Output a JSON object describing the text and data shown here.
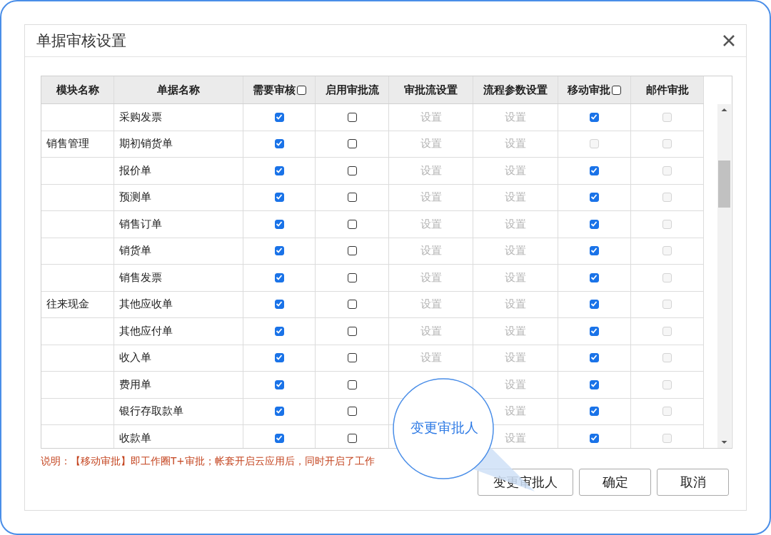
{
  "dialog": {
    "title": "单据审核设置"
  },
  "table": {
    "columns": [
      {
        "label": "模块名称",
        "kind": "text"
      },
      {
        "label": "单据名称",
        "kind": "text"
      },
      {
        "label": "需要审核",
        "kind": "check",
        "header_checked": false
      },
      {
        "label": "启用审批流",
        "kind": "plain"
      },
      {
        "label": "审批流设置",
        "kind": "plain"
      },
      {
        "label": "流程参数设置",
        "kind": "plain"
      },
      {
        "label": "移动审批",
        "kind": "check",
        "header_checked": false
      },
      {
        "label": "邮件审批",
        "kind": "plain"
      }
    ],
    "rows": [
      {
        "module": "",
        "document": "采购发票",
        "audit": true,
        "flow": false,
        "flow_setting": "设置",
        "param_setting": "设置",
        "mobile": true,
        "mobile_disabled": false,
        "mail": false,
        "mail_disabled": true
      },
      {
        "module": "销售管理",
        "document": "期初销货单",
        "audit": true,
        "flow": false,
        "flow_setting": "设置",
        "param_setting": "设置",
        "mobile": false,
        "mobile_disabled": true,
        "mail": false,
        "mail_disabled": true
      },
      {
        "module": "",
        "document": "报价单",
        "audit": true,
        "flow": false,
        "flow_setting": "设置",
        "param_setting": "设置",
        "mobile": true,
        "mobile_disabled": false,
        "mail": false,
        "mail_disabled": true
      },
      {
        "module": "",
        "document": "预测单",
        "audit": true,
        "flow": false,
        "flow_setting": "设置",
        "param_setting": "设置",
        "mobile": true,
        "mobile_disabled": false,
        "mail": false,
        "mail_disabled": true
      },
      {
        "module": "",
        "document": "销售订单",
        "audit": true,
        "flow": false,
        "flow_setting": "设置",
        "param_setting": "设置",
        "mobile": true,
        "mobile_disabled": false,
        "mail": false,
        "mail_disabled": true
      },
      {
        "module": "",
        "document": "销货单",
        "audit": true,
        "flow": false,
        "flow_setting": "设置",
        "param_setting": "设置",
        "mobile": true,
        "mobile_disabled": false,
        "mail": false,
        "mail_disabled": true
      },
      {
        "module": "",
        "document": "销售发票",
        "audit": true,
        "flow": false,
        "flow_setting": "设置",
        "param_setting": "设置",
        "mobile": true,
        "mobile_disabled": false,
        "mail": false,
        "mail_disabled": true
      },
      {
        "module": "往来现金",
        "document": "其他应收单",
        "audit": true,
        "flow": false,
        "flow_setting": "设置",
        "param_setting": "设置",
        "mobile": true,
        "mobile_disabled": false,
        "mail": false,
        "mail_disabled": true
      },
      {
        "module": "",
        "document": "其他应付单",
        "audit": true,
        "flow": false,
        "flow_setting": "设置",
        "param_setting": "设置",
        "mobile": true,
        "mobile_disabled": false,
        "mail": false,
        "mail_disabled": true
      },
      {
        "module": "",
        "document": "收入单",
        "audit": true,
        "flow": false,
        "flow_setting": "设置",
        "param_setting": "设置",
        "mobile": true,
        "mobile_disabled": false,
        "mail": false,
        "mail_disabled": true
      },
      {
        "module": "",
        "document": "费用单",
        "audit": true,
        "flow": false,
        "param_setting": "设置",
        "mobile": true,
        "mobile_disabled": false,
        "mail": false,
        "mail_disabled": true
      },
      {
        "module": "",
        "document": "银行存取款单",
        "audit": true,
        "flow": false,
        "param_setting": "设置",
        "mobile": true,
        "mobile_disabled": false,
        "mail": false,
        "mail_disabled": true
      },
      {
        "module": "",
        "document": "收款单",
        "audit": true,
        "flow": false,
        "param_setting": "设置",
        "mobile": true,
        "mobile_disabled": false,
        "mail": false,
        "mail_disabled": true
      }
    ]
  },
  "note": "说明：【移动审批】即工作圈T+审批；帐套开启云应用后，同时开启了工作",
  "callout": "变更审批人",
  "buttons": [
    "变更审批人",
    "确定",
    "取消"
  ]
}
